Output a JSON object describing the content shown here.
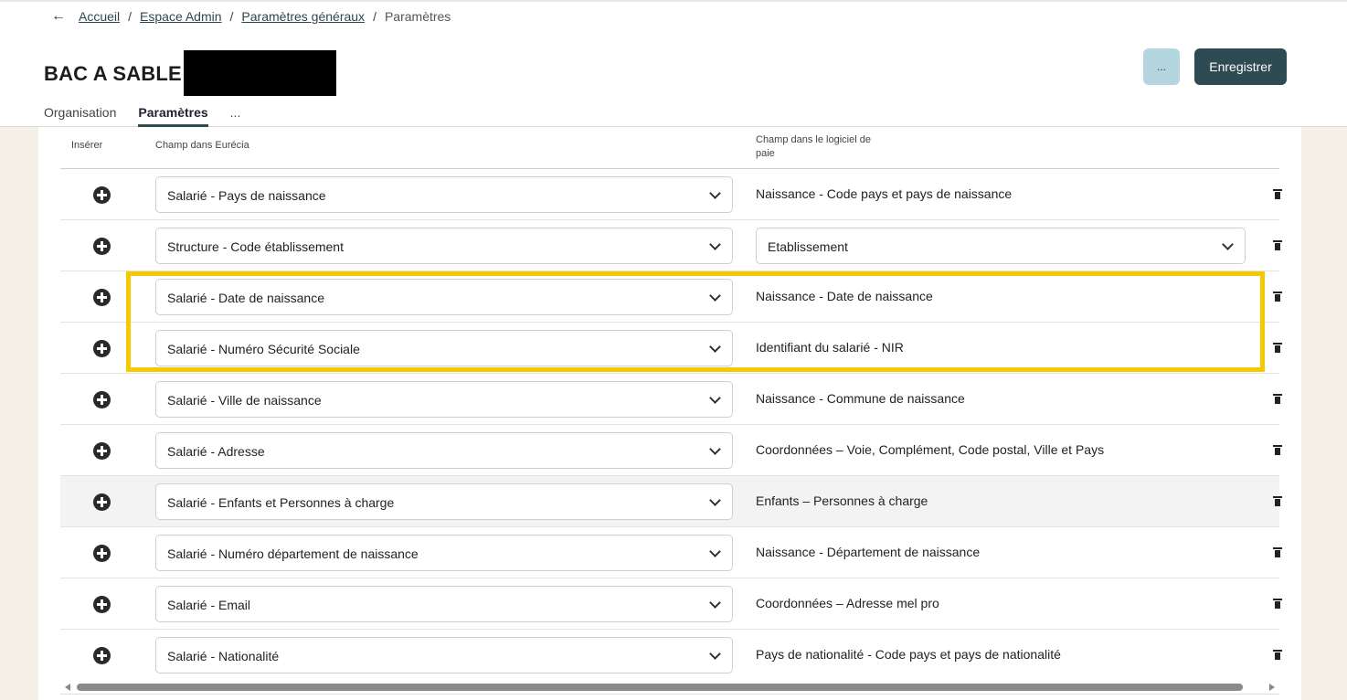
{
  "breadcrumb": {
    "back_icon": "arrow-left-icon",
    "items": [
      "Accueil",
      "Espace Admin",
      "Paramètres généraux"
    ],
    "current": "Paramètres",
    "separator": "/"
  },
  "header": {
    "title": "BAC A SABLE",
    "more_button": "...",
    "save_button": "Enregistrer"
  },
  "tabs": [
    "Organisation",
    "Paramètres",
    "..."
  ],
  "table": {
    "headers": {
      "insert": "Insérer",
      "eurecia": "Champ dans Eurécia",
      "payroll_line1": "Champ dans le logiciel de",
      "payroll_line2": "paie"
    },
    "rows": [
      {
        "eurecia": "Salarié - Pays de naissance",
        "payroll": "Naissance - Code pays et pays de naissance"
      },
      {
        "eurecia": "Structure - Code établissement",
        "payroll": "Etablissement"
      },
      {
        "eurecia": "Salarié - Date de naissance",
        "payroll": "Naissance - Date de naissance"
      },
      {
        "eurecia": "Salarié - Numéro Sécurité Sociale",
        "payroll": "Identifiant du salarié - NIR"
      },
      {
        "eurecia": "Salarié - Ville de naissance",
        "payroll": "Naissance - Commune de naissance"
      },
      {
        "eurecia": "Salarié - Adresse",
        "payroll": "Coordonnées – Voie, Complément, Code postal, Ville et Pays"
      },
      {
        "eurecia": "Salarié - Enfants et Personnes à charge",
        "payroll": "Enfants – Personnes à charge"
      },
      {
        "eurecia": "Salarié - Numéro département de naissance",
        "payroll": "Naissance - Département de naissance"
      },
      {
        "eurecia": "Salarié - Email",
        "payroll": "Coordonnées – Adresse mel pro"
      },
      {
        "eurecia": "Salarié - Nationalité",
        "payroll": "Pays de nationalité - Code pays et pays de nationalité"
      }
    ]
  },
  "colors": {
    "accent": "#2e4a52",
    "secondary_button": "#b4d6df",
    "highlight": "#f5c800",
    "background": "#f4f0e6"
  }
}
